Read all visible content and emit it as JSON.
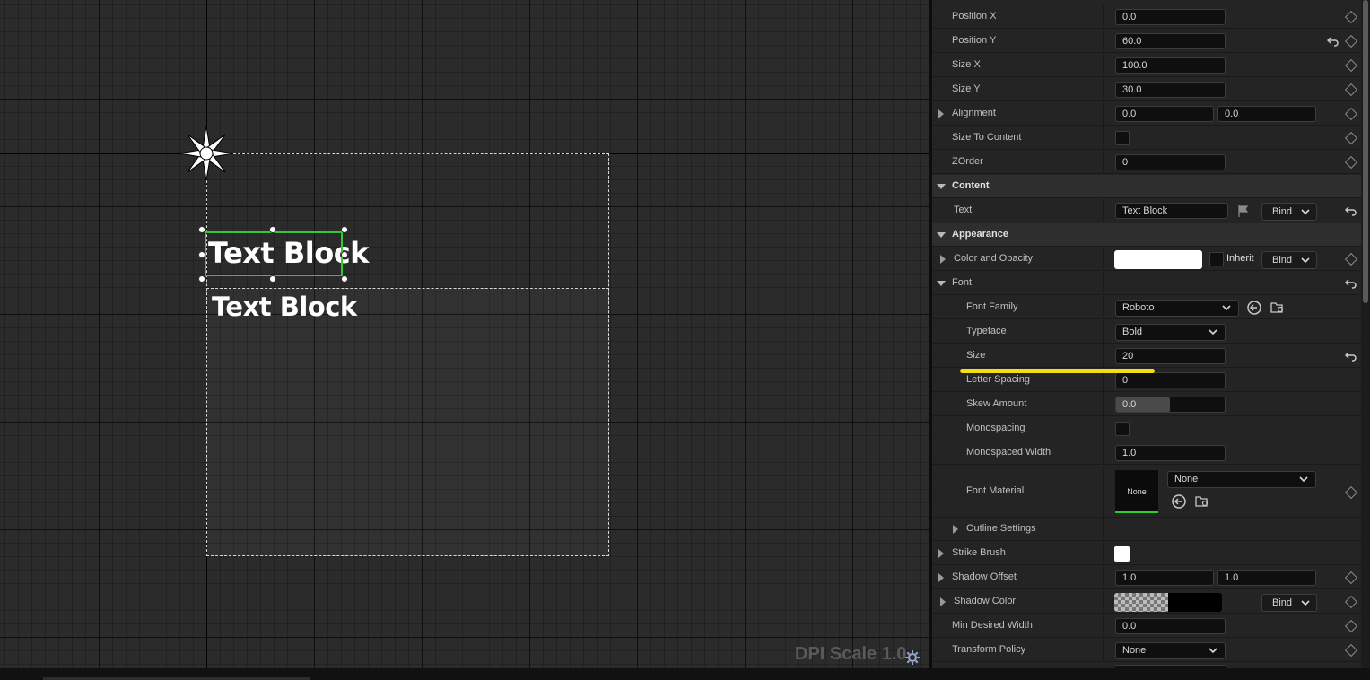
{
  "canvas": {
    "text_block_1": "Text Block",
    "text_block_2": "Text Block",
    "dpi_label": "DPI Scale 1.0"
  },
  "details": {
    "position_x": {
      "label": "Position X",
      "value": "0.0"
    },
    "position_y": {
      "label": "Position Y",
      "value": "60.0"
    },
    "size_x": {
      "label": "Size X",
      "value": "100.0"
    },
    "size_y": {
      "label": "Size Y",
      "value": "30.0"
    },
    "alignment": {
      "label": "Alignment",
      "x": "0.0",
      "y": "0.0"
    },
    "size_to_content": {
      "label": "Size To Content"
    },
    "zorder": {
      "label": "ZOrder",
      "value": "0"
    },
    "content_category": "Content",
    "text": {
      "label": "Text",
      "value": "Text Block",
      "bind": "Bind"
    },
    "appearance_category": "Appearance",
    "color_opacity": {
      "label": "Color and Opacity",
      "inherit": "Inherit",
      "bind": "Bind",
      "swatch": "#ffffff"
    },
    "font": {
      "label": "Font"
    },
    "font_family": {
      "label": "Font Family",
      "value": "Roboto"
    },
    "typeface": {
      "label": "Typeface",
      "value": "Bold"
    },
    "size": {
      "label": "Size",
      "value": "20"
    },
    "letter_spacing": {
      "label": "Letter Spacing",
      "value": "0"
    },
    "skew_amount": {
      "label": "Skew Amount",
      "value": "0.0"
    },
    "monospacing": {
      "label": "Monospacing"
    },
    "monospaced_width": {
      "label": "Monospaced Width",
      "value": "1.0"
    },
    "font_material": {
      "label": "Font Material",
      "thumb": "None",
      "value": "None"
    },
    "outline_settings": {
      "label": "Outline Settings"
    },
    "strike_brush": {
      "label": "Strike Brush"
    },
    "shadow_offset": {
      "label": "Shadow Offset",
      "x": "1.0",
      "y": "1.0"
    },
    "shadow_color": {
      "label": "Shadow Color",
      "bind": "Bind"
    },
    "min_desired_width": {
      "label": "Min Desired Width",
      "value": "0.0"
    },
    "transform_policy": {
      "label": "Transform Policy",
      "value": "None"
    }
  },
  "colors": {
    "selection": "#2ecc2e",
    "highlight": "#f2dd16"
  }
}
